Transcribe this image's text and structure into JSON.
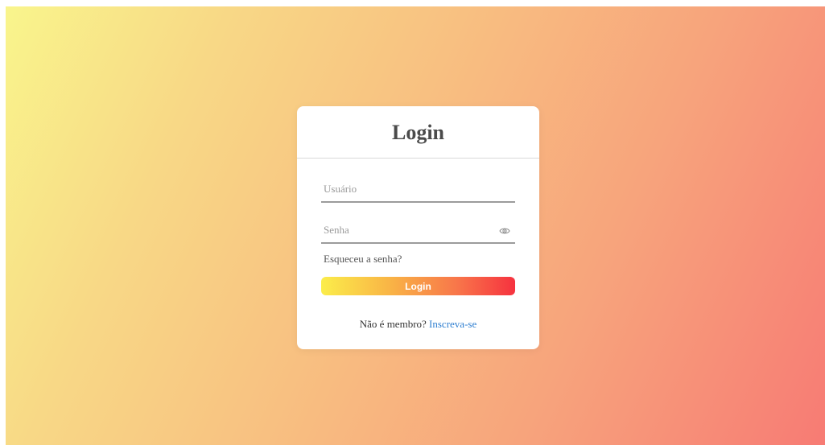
{
  "card": {
    "title": "Login"
  },
  "form": {
    "username_placeholder": "Usuário",
    "username_value": "",
    "password_placeholder": "Senha",
    "password_value": "",
    "show_password_icon": "eye-icon",
    "forgot_password": "Esqueceu a senha?",
    "login_button": "Login",
    "signup_prompt": "Não é membro?",
    "signup_link": "Inscreva-se"
  },
  "colors": {
    "background_start": "#f9f58c",
    "background_end": "#f77b74",
    "button_start": "#fbed4a",
    "button_end": "#f6323f",
    "link": "#2f7fd0"
  }
}
